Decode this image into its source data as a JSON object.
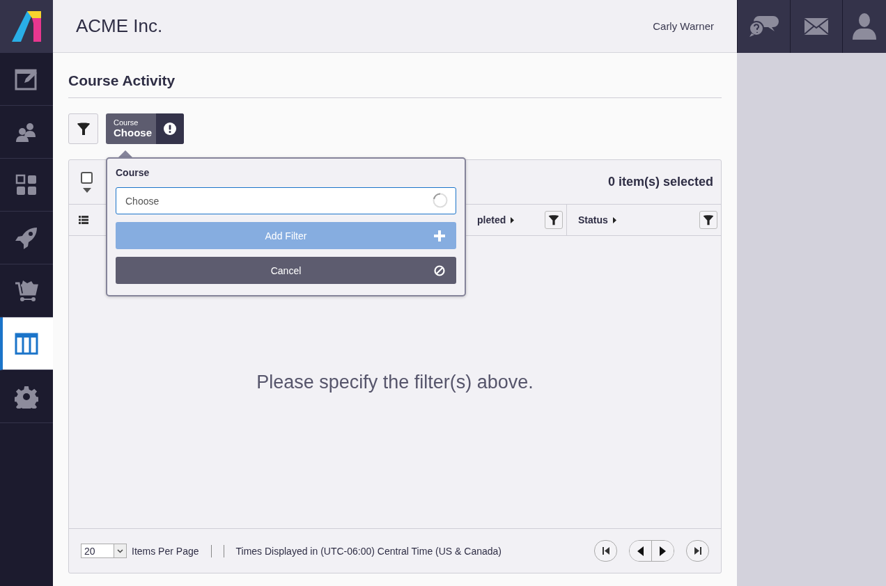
{
  "sidebar": {
    "items": [
      {
        "selected": false
      },
      {
        "selected": false
      },
      {
        "selected": false
      },
      {
        "selected": false
      },
      {
        "selected": false
      },
      {
        "selected": true
      },
      {
        "selected": false
      }
    ]
  },
  "header": {
    "company": "ACME Inc.",
    "user": "Carly Warner"
  },
  "page": {
    "title": "Course Activity"
  },
  "filter_chip": {
    "label": "Course",
    "value": "Choose"
  },
  "popover": {
    "title": "Course",
    "field": {
      "placeholder": "Choose"
    },
    "add_button": {
      "label": "Add Filter",
      "disabled": true
    },
    "cancel_button": {
      "label": "Cancel"
    }
  },
  "grid": {
    "select_all": {
      "checked": false
    },
    "selection_count": "0 item(s) selected",
    "columns": [
      {
        "label": "pleted"
      },
      {
        "label": "Status"
      }
    ],
    "empty_message": "Please specify the filter(s) above.",
    "footer": {
      "page_size": "20",
      "page_size_label": "Items Per Page",
      "timezone": "Times Displayed in (UTC-06:00) Central Time (US & Canada)"
    }
  }
}
